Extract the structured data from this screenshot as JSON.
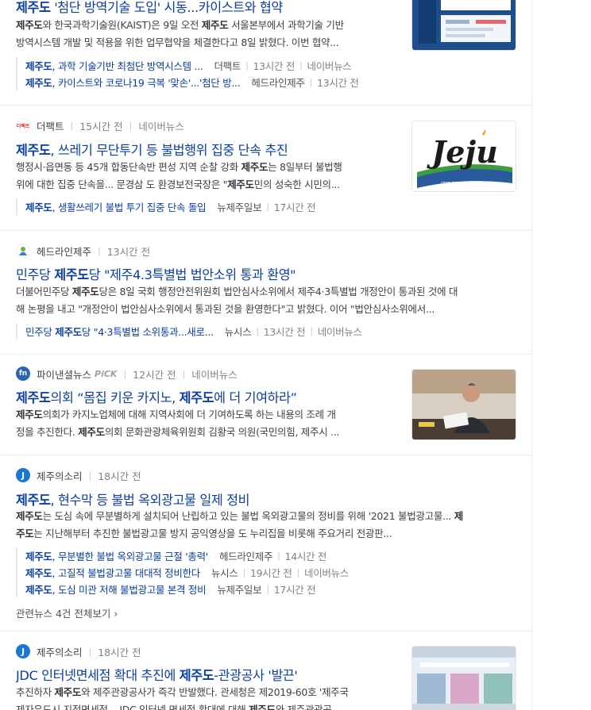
{
  "item1": {
    "title_pre": "제주도",
    "title_post": " '첨단 방역기술 도입' 시동...카이스트와 협약",
    "desc1": [
      "",
      "제주도",
      "와 한국과학기술원(KAIST)은 9일 오전 ",
      "제주도",
      " 서울본부에서 과학기술 기반"
    ],
    "desc2": "방역시스템 개발 및 적용을 위한 업무협약을 체결한다고 8일 밝혔다. 이번 협약...",
    "related": [
      {
        "b": "제주도",
        "t": ", 과학 기술기반 최첨단 방역시스템 ...",
        "press": "더팩트",
        "time": "13시간 전",
        "portal": "네이버뉴스"
      },
      {
        "b": "제주도",
        "t": ", 카이스트와 코로나19 극복 '맞손'...'첨단 방...",
        "press": "헤드라인제주",
        "time": "13시간 전",
        "portal": ""
      }
    ]
  },
  "item2": {
    "press": "더팩트",
    "time": "15시간 전",
    "portal": "네이버뉴스",
    "title_pre": "제주도",
    "title_post": ", 쓰레기 무단투기 등 불법행위 집중 단속 추진",
    "desc1": [
      "행정시·읍면동 등 45개 합동단속반 편성 지역 순찰 강화 ",
      "제주도",
      "는 8일부터 불법행"
    ],
    "desc2": [
      "위에 대한 집중 단속을... 문경삼 도 환경보전국장은 \"",
      "제주도",
      "민의 성숙한 시민의..."
    ],
    "related": [
      {
        "b": "제주도",
        "t": ", 생활쓰레기 불법 투기 집중 단속 돌입",
        "press": "뉴제주일보",
        "time": "17시간 전",
        "portal": ""
      }
    ],
    "thumb_text": "Jeju",
    "thumb_caption": "THE FACT"
  },
  "item3": {
    "press": "헤드라인제주",
    "time": "13시간 전",
    "title_pre": "민주당 ",
    "title_bold": "제주도",
    "title_post": "당 \"제주4.3특별법 법안소위 통과 환영\"",
    "desc1": [
      "더불어민주당 ",
      "제주도",
      "당은 8일 국회 행정안전위원회 법안심사소위에서 제주4·3특별법 개정안이 통과된 것에 대"
    ],
    "desc2": "해 논평을 내고 \"개정안이 법안심사소위에서 통과된 것을 환영한다\"고 밝혔다. 이어 \"법안심사소위에서...",
    "related": [
      {
        "pre": "민주당 ",
        "b": "제주도",
        "t": "당 \"4·3특별법 소위통과...새로...",
        "press": "뉴시스",
        "time": "13시간 전",
        "portal": "네이버뉴스"
      }
    ]
  },
  "item4": {
    "press": "파이낸셜뉴스",
    "pick": "PiCK",
    "time": "12시간 전",
    "portal": "네이버뉴스",
    "title_pre": "제주도",
    "title_mid": "의회 “몸집 키운 카지노, ",
    "title_bold2": "제주도",
    "title_post": "에 더 기여하라”",
    "desc1": [
      "",
      "제주도",
      "의회가 카지노업체에 대해 지역사회에 더 기여하도록 하는 내용의 조례 개"
    ],
    "desc2": [
      "정을 추진한다. ",
      "제주도",
      "의회 문화관광체육위원회 김황국 의원(국민의힘, 제주시 ..."
    ]
  },
  "item5": {
    "press": "제주의소리",
    "time": "18시간 전",
    "title_pre": "제주도",
    "title_post": ", 현수막 등 불법 옥외광고물 일제 정비",
    "desc1": [
      "",
      "제주도",
      "는 도심 속에 무분별하게 설치되어 난립하고 있는 불법 옥외광고물의 정비를 위해 '2021 불법광고물... ",
      "제",
      ""
    ],
    "desc2": [
      "",
      "주도",
      "는 지난해부터 추진한 불법광고물 방지 공익영상을 도 누리집을 비롯해 주요거리 전광판..."
    ],
    "related": [
      {
        "b": "제주도",
        "t": ", 무분별한 불법 옥외광고물 근절 '총력'",
        "press": "헤드라인제주",
        "time": "14시간 전",
        "portal": ""
      },
      {
        "b": "제주도",
        "t": ", 고질적 불법광고물 대대적 정비한다",
        "press": "뉴시스",
        "time": "19시간 전",
        "portal": "네이버뉴스"
      },
      {
        "b": "제주도",
        "t": ", 도심 미관 저해 불법광고물 본격 정비",
        "press": "뉴제주일보",
        "time": "17시간 전",
        "portal": ""
      }
    ],
    "more": "관련뉴스 4건 전체보기 ›"
  },
  "item6": {
    "press": "제주의소리",
    "time": "18시간 전",
    "title_pre": "JDC 인터넷면세점 확대 추진에 ",
    "title_bold": "제주도",
    "title_post": "-관광공사 '발끈'",
    "desc1": [
      "추진하자 ",
      "제주도",
      "와 제주관광공사가 즉각 반발했다. 관세청은 제2019-60호 '제주국"
    ],
    "desc2": [
      "제자유도시 지정면세점... JDC 인터넷 면세점 확대에 대해 ",
      "제주도",
      "와 제주관광공"
    ]
  },
  "colors": {
    "link": "#0b3ea1",
    "meta": "#80808a",
    "divider": "#ebebeb"
  }
}
